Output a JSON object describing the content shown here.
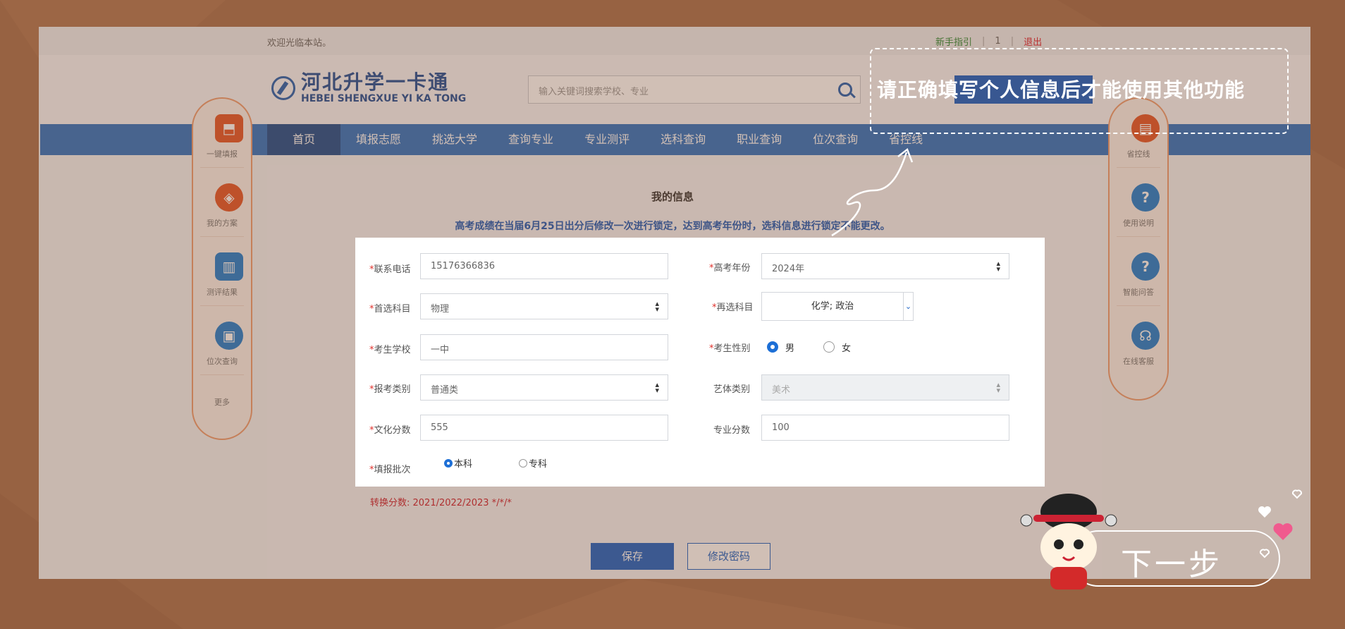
{
  "topbar": {
    "welcome": "欢迎光临本站。",
    "guide": "新手指引",
    "user": "1",
    "logout": "退出"
  },
  "logo": {
    "cn": "河北升学一卡通",
    "en": "HEBEI SHENGXUE YI KA TONG"
  },
  "search": {
    "placeholder": "输入关键词搜索学校、专业"
  },
  "nav": [
    {
      "label": "首页",
      "active": true
    },
    {
      "label": "填报志愿"
    },
    {
      "label": "挑选大学"
    },
    {
      "label": "查询专业"
    },
    {
      "label": "专业测评"
    },
    {
      "label": "选科查询"
    },
    {
      "label": "职业查询"
    },
    {
      "label": "位次查询"
    },
    {
      "label": "省控线"
    }
  ],
  "left_sidebar": [
    {
      "label": "一键填报",
      "icon": "one-click-fill-icon",
      "color": "#e4562a"
    },
    {
      "label": "我的方案",
      "icon": "layers-icon",
      "color": "#e4562a"
    },
    {
      "label": "测评结果",
      "icon": "bar-chart-icon",
      "color": "#1f7fd1"
    },
    {
      "label": "位次查询",
      "icon": "rank-icon",
      "color": "#1f7fd1"
    },
    {
      "label": "更多",
      "icon": "",
      "color": ""
    }
  ],
  "right_sidebar": [
    {
      "label": "省控线",
      "icon": "control-line-icon",
      "color": "#e4562a"
    },
    {
      "label": "使用说明",
      "icon": "help-icon",
      "color": "#1f7fd1"
    },
    {
      "label": "智能问答",
      "icon": "smart-qa-icon",
      "color": "#1f7fd1"
    },
    {
      "label": "在线客服",
      "icon": "headset-icon",
      "color": "#1f7fd1"
    }
  ],
  "page": {
    "title": "我的信息",
    "notice": "高考成绩在当届6月25日出分后修改一次进行锁定，达到高考年份时，选科信息进行锁定不能更改。",
    "convert": "转换分数: 2021/2022/2023    */*/*"
  },
  "form": {
    "phone_label": "联系电话",
    "phone": "15176366836",
    "year_label": "高考年份",
    "year": "2024年",
    "first_subject_label": "首选科目",
    "first_subject": "物理",
    "second_subject_label": "再选科目",
    "second_subject": "化学; 政治",
    "school_label": "考生学校",
    "school": "一中",
    "gender_label": "考生性别",
    "gender_male": "男",
    "gender_female": "女",
    "category_label": "报考类别",
    "category": "普通类",
    "art_label": "艺体类别",
    "art": "美术",
    "culture_label": "文化分数",
    "culture": "555",
    "major_label": "专业分数",
    "major": "100",
    "batch_label": "填报批次",
    "batch_undergrad": "本科",
    "batch_college": "专科"
  },
  "buttons": {
    "save": "保存",
    "change_password": "修改密码"
  },
  "guide": {
    "tip": "请正确填写个人信息后才能使用其他功能",
    "next": "下一步"
  },
  "colors": {
    "brand_blue": "#2f73c4",
    "accent_orange": "#ee9d72",
    "required": "#e0302b"
  }
}
